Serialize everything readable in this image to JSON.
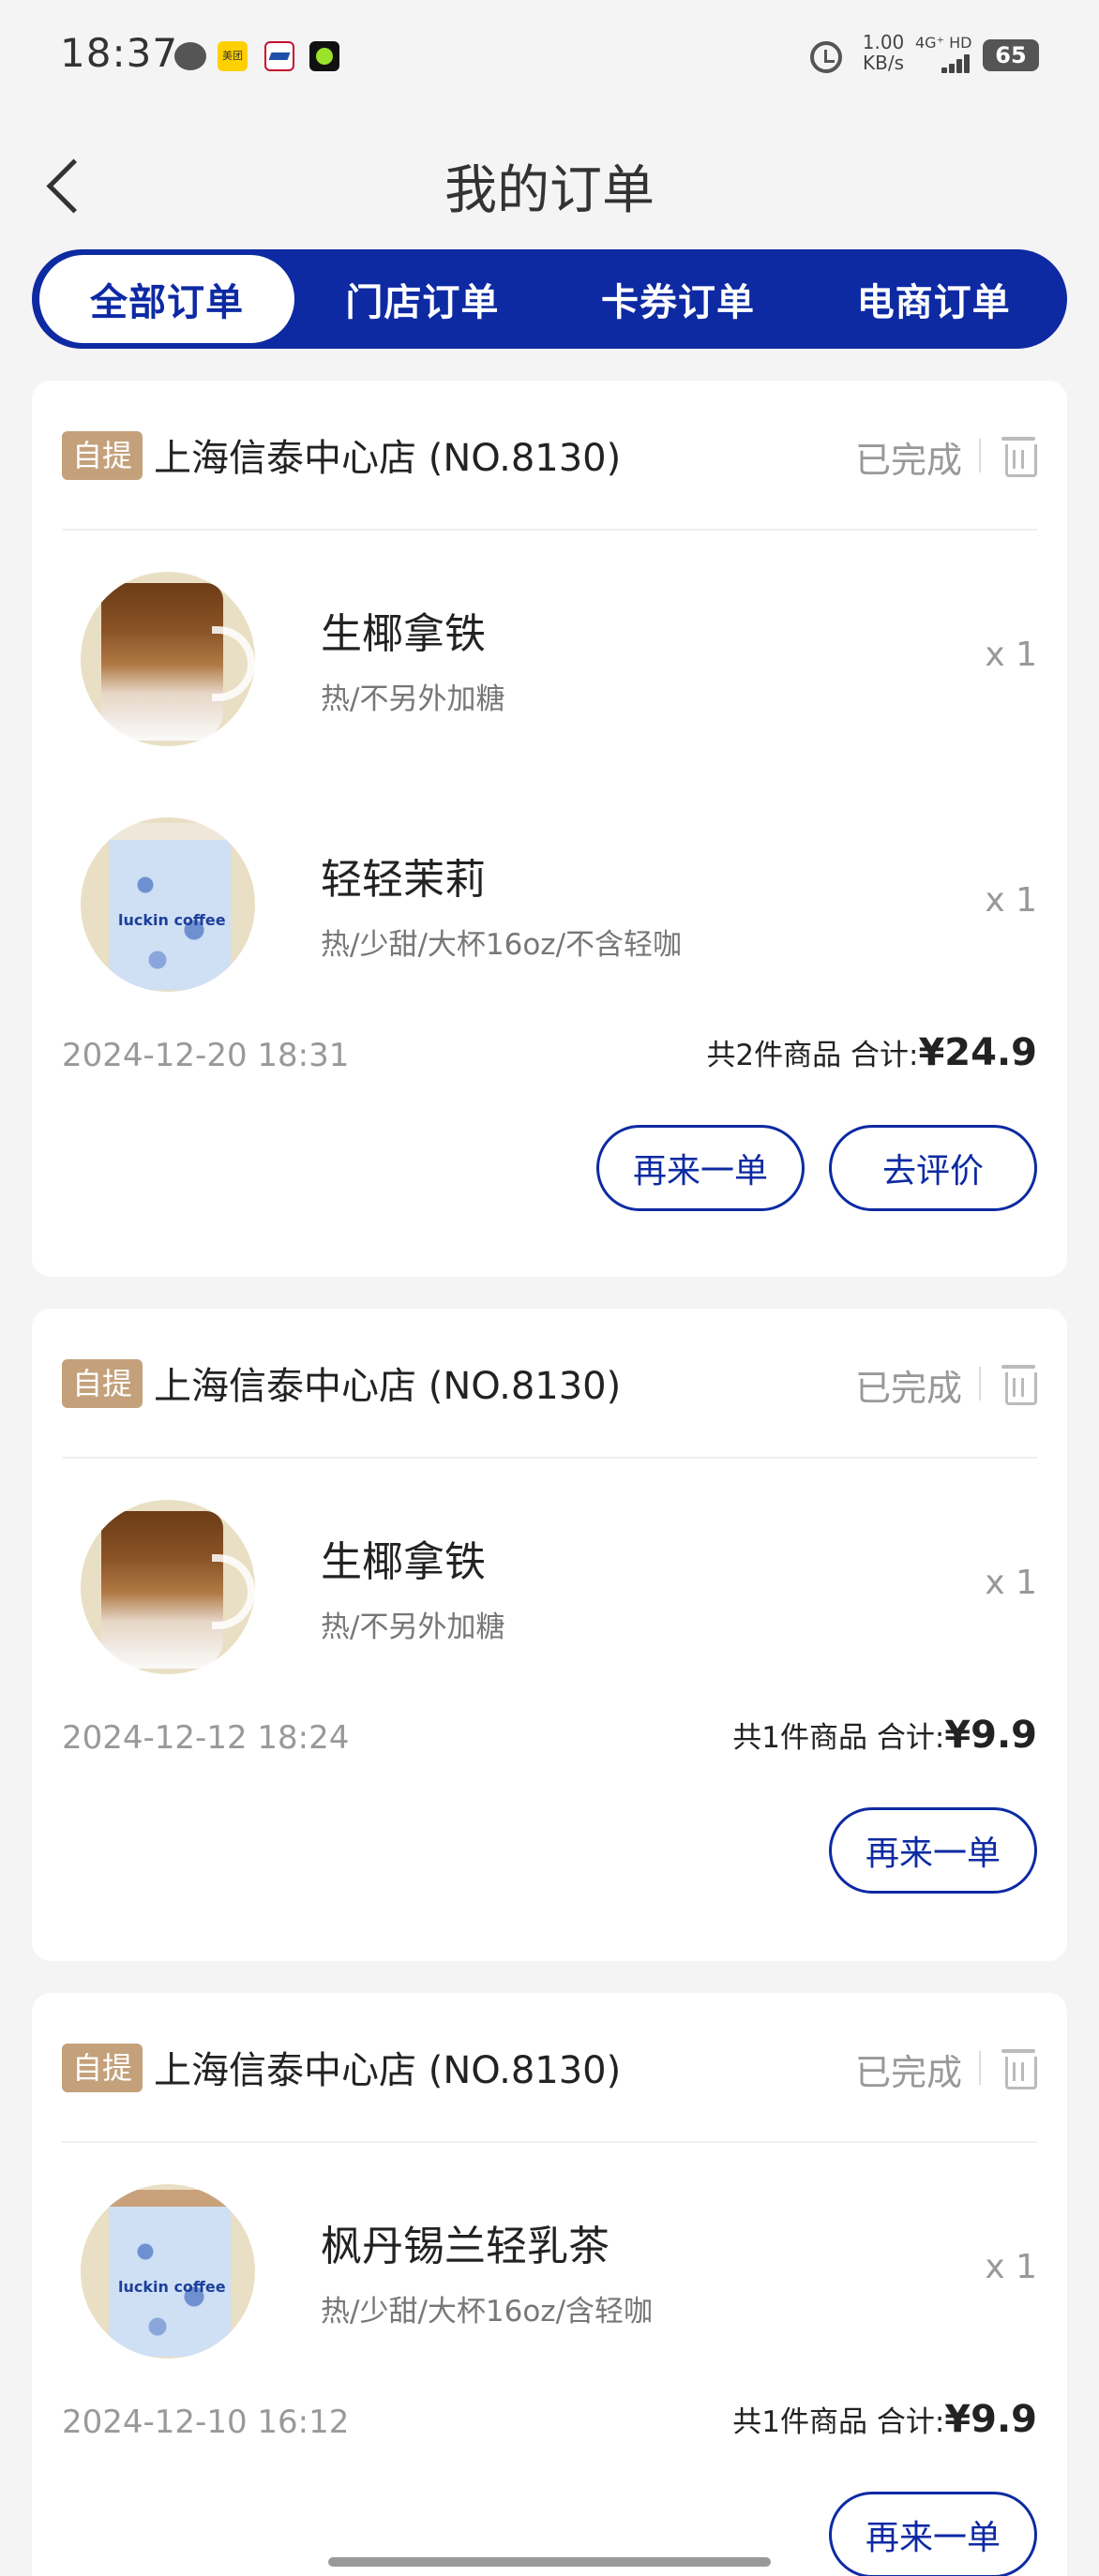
{
  "status_bar": {
    "time": "18:37",
    "network_speed_value": "1.00",
    "network_speed_unit": "KB/s",
    "network_type": "4G⁺ HD",
    "battery": "65",
    "icons": [
      "chat-icon",
      "meituan-icon",
      "app-icon",
      "app-icon",
      "alarm-icon",
      "signal-icon",
      "battery-icon"
    ]
  },
  "header": {
    "title": "我的订单",
    "back_icon": "chevron-left-icon"
  },
  "tabs": [
    {
      "label": "全部订单",
      "active": true
    },
    {
      "label": "门店订单",
      "active": false
    },
    {
      "label": "卡券订单",
      "active": false
    },
    {
      "label": "电商订单",
      "active": false
    }
  ],
  "colors": {
    "brand_blue": "#0d2aa3",
    "pickup_badge": "#c4a17b",
    "background": "#f4f4f4"
  },
  "orders": [
    {
      "badge": "自提",
      "store": "上海信泰中心店 (NO.8130)",
      "status": "已完成",
      "items": [
        {
          "name": "生椰拿铁",
          "spec": "热/不另外加糖",
          "qty": "x 1",
          "image": "latte"
        },
        {
          "name": "轻轻茉莉",
          "spec": "热/少甜/大杯16oz/不含轻咖",
          "qty": "x 1",
          "image": "cup"
        }
      ],
      "time": "2024-12-20 18:31",
      "count_text": "共2件商品 合计:",
      "price": "¥24.9",
      "buttons": [
        "再来一单",
        "去评价"
      ]
    },
    {
      "badge": "自提",
      "store": "上海信泰中心店 (NO.8130)",
      "status": "已完成",
      "items": [
        {
          "name": "生椰拿铁",
          "spec": "热/不另外加糖",
          "qty": "x 1",
          "image": "latte"
        }
      ],
      "time": "2024-12-12 18:24",
      "count_text": "共1件商品 合计:",
      "price": "¥9.9",
      "buttons": [
        "再来一单"
      ]
    },
    {
      "badge": "自提",
      "store": "上海信泰中心店 (NO.8130)",
      "status": "已完成",
      "items": [
        {
          "name": "枫丹锡兰轻乳茶",
          "spec": "热/少甜/大杯16oz/含轻咖",
          "qty": "x 1",
          "image": "cup"
        }
      ],
      "time": "2024-12-10 16:12",
      "count_text": "共1件商品 合计:",
      "price": "¥9.9",
      "buttons": [
        "再来一单"
      ]
    }
  ],
  "cup_brand_text": "luckin coffee"
}
